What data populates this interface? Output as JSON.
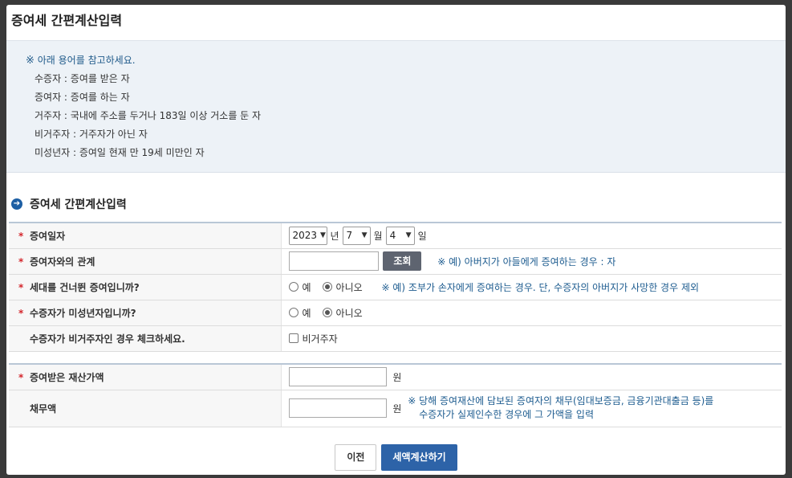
{
  "page": {
    "title": "증여세 간편계산입력"
  },
  "notice": {
    "mark": "※",
    "header": "아래 용어를 참고하세요.",
    "terms": [
      "수증자 : 증여를 받은 자",
      "증여자 : 증여를 하는 자",
      "거주자 : 국내에 주소를 두거나 183일 이상 거소를 둔 자",
      "비거주자 : 거주자가 아닌 자",
      "미성년자 : 증여일 현재 만 19세 미만인 자"
    ]
  },
  "section": {
    "title": "증여세 간편계산입력",
    "icon": "arrow-circle-icon"
  },
  "form": {
    "required_mark": "*",
    "gift_date": {
      "label": "증여일자",
      "year": "2023",
      "year_unit": "년",
      "month": "7",
      "month_unit": "월",
      "day": "4",
      "day_unit": "일"
    },
    "relation": {
      "label": "증여자와의 관계",
      "value": "",
      "search_button": "조회",
      "hint": "※ 예) 아버지가 아들에게 증여하는 경우 : 자"
    },
    "generation_skip": {
      "label": "세대를 건너뛴 증여입니까?",
      "yes": "예",
      "no": "아니오",
      "selected": "no",
      "hint": "※ 예) 조부가 손자에게 증여하는 경우. 단, 수증자의 아버지가 사망한 경우 제외"
    },
    "minor": {
      "label": "수증자가 미성년자입니까?",
      "yes": "예",
      "no": "아니오",
      "selected": "no"
    },
    "nonresident": {
      "label": "수증자가 비거주자인 경우 체크하세요.",
      "checkbox_label": "비거주자",
      "checked": false
    },
    "property_value": {
      "label": "증여받은 재산가액",
      "value": "",
      "unit": "원"
    },
    "debt": {
      "label": "채무액",
      "value": "",
      "unit": "원",
      "note_line1": "※ 당해 증여재산에 담보된 증여자의 채무(임대보증금, 금융기관대출금 등)를",
      "note_line2": "수증자가 실제인수한 경우에 그 가액을 입력"
    }
  },
  "buttons": {
    "prev": "이전",
    "calculate": "세액계산하기"
  },
  "colors": {
    "accent": "#2d63a8",
    "hint": "#1c5b8f",
    "required": "#d4262c",
    "notice_bg": "#edf2f7"
  }
}
